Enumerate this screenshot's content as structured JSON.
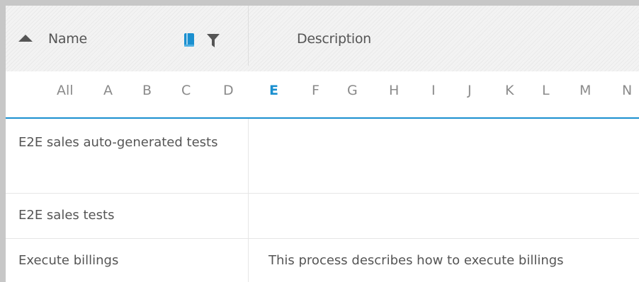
{
  "header": {
    "name_label": "Name",
    "description_label": "Description",
    "sort_icon": "sort-ascending-icon",
    "book_icon": "book-icon",
    "filter_icon": "filter-icon",
    "accent_color": "#1a8fcf"
  },
  "alphabet": {
    "letters": [
      "All",
      "A",
      "B",
      "C",
      "D",
      "E",
      "F",
      "G",
      "H",
      "I",
      "J",
      "K",
      "L",
      "M",
      "N"
    ],
    "active": "E"
  },
  "rows": [
    {
      "name": "E2E sales auto-generated tests",
      "description": ""
    },
    {
      "name": "E2E sales tests",
      "description": ""
    },
    {
      "name": "Execute billings",
      "description": "This process describes how to execute billings"
    }
  ]
}
